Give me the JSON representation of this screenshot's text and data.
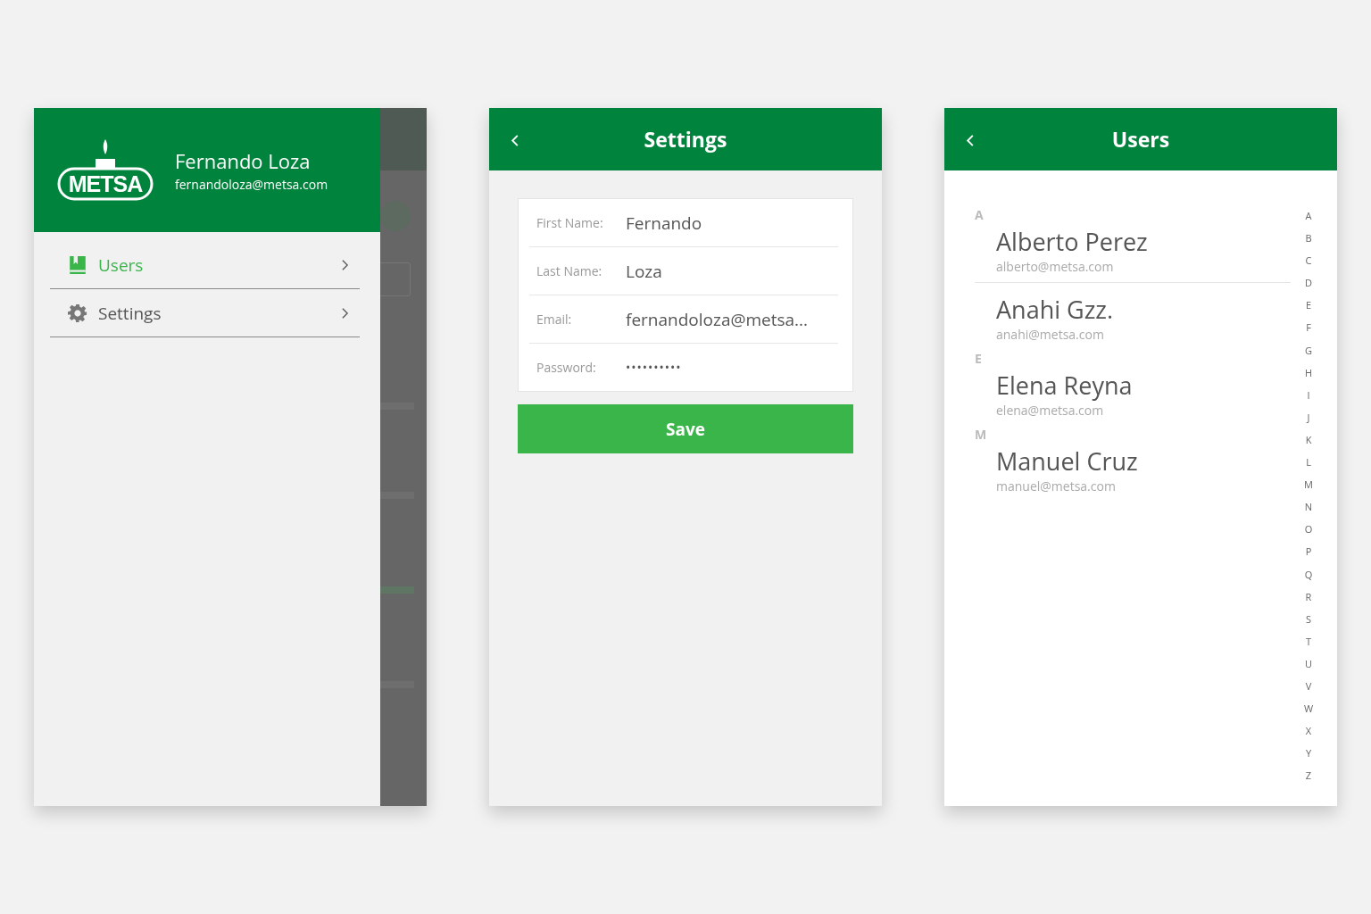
{
  "drawer_screen": {
    "logo_text": "METSA",
    "user_name": "Fernando Loza",
    "user_email": "fernandoloza@metsa.com",
    "menu": [
      {
        "label": "Users",
        "kind": "users",
        "selected": true
      },
      {
        "label": "Settings",
        "kind": "settings",
        "selected": false
      }
    ]
  },
  "settings_screen": {
    "title": "Settings",
    "fields": [
      {
        "label": "First Name:",
        "value": "Fernando",
        "kind": "text"
      },
      {
        "label": "Last Name:",
        "value": "Loza",
        "kind": "text"
      },
      {
        "label": "Email:",
        "value": "fernandoloza@metsa...",
        "kind": "text"
      },
      {
        "label": "Password:",
        "value": "••••••••••",
        "kind": "password"
      }
    ],
    "save_button": "Save"
  },
  "users_screen": {
    "title": "Users",
    "sections": [
      {
        "letter": "A",
        "users": [
          {
            "name": "Alberto Perez",
            "email": "alberto@metsa.com"
          },
          {
            "name": "Anahi Gzz.",
            "email": "anahi@metsa.com"
          }
        ]
      },
      {
        "letter": "E",
        "users": [
          {
            "name": "Elena Reyna",
            "email": "elena@metsa.com"
          }
        ]
      },
      {
        "letter": "M",
        "users": [
          {
            "name": "Manuel Cruz",
            "email": "manuel@metsa.com"
          }
        ]
      }
    ],
    "index_letters": [
      "A",
      "B",
      "C",
      "D",
      "E",
      "F",
      "G",
      "H",
      "I",
      "J",
      "K",
      "L",
      "M",
      "N",
      "O",
      "P",
      "Q",
      "R",
      "S",
      "T",
      "U",
      "V",
      "W",
      "X",
      "Y",
      "Z"
    ]
  }
}
